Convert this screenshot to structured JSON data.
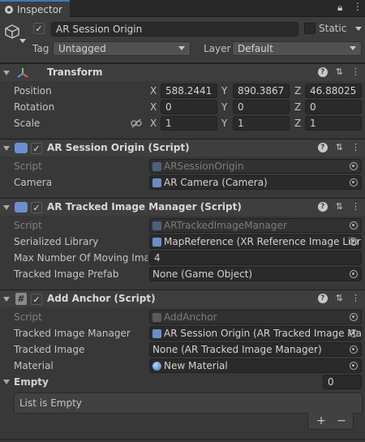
{
  "tab": {
    "title": "Inspector"
  },
  "header": {
    "object_name": "AR Session Origin",
    "static_label": "Static",
    "tag_label": "Tag",
    "tag_value": "Untagged",
    "layer_label": "Layer",
    "layer_value": "Default"
  },
  "transform": {
    "title": "Transform",
    "rows": [
      {
        "label": "Position",
        "x": "588.2441",
        "y": "890.3867",
        "z": "46.88025"
      },
      {
        "label": "Rotation",
        "x": "0",
        "y": "0",
        "z": "0"
      },
      {
        "label": "Scale",
        "x": "1",
        "y": "1",
        "z": "1"
      }
    ],
    "axis": {
      "x": "X",
      "y": "Y",
      "z": "Z"
    }
  },
  "session_origin": {
    "title": "AR Session Origin (Script)",
    "script_label": "Script",
    "script_value": "ARSessionOrigin",
    "camera_label": "Camera",
    "camera_value": "AR Camera (Camera)"
  },
  "image_manager": {
    "title": "AR Tracked Image Manager (Script)",
    "script_label": "Script",
    "script_value": "ARTrackedImageManager",
    "library_label": "Serialized Library",
    "library_value": "MapReference (XR Reference Image Libra",
    "max_label": "Max Number Of Moving Images",
    "max_value": "4",
    "prefab_label": "Tracked Image Prefab",
    "prefab_value": "None (Game Object)"
  },
  "add_anchor": {
    "title": "Add Anchor (Script)",
    "script_label": "Script",
    "script_value": "AddAnchor",
    "tim_label": "Tracked Image Manager",
    "tim_value": "AR Session Origin (AR Tracked Image Ma",
    "ti_label": "Tracked Image",
    "ti_value": "None (AR Tracked Image Manager)",
    "material_label": "Material",
    "material_value": "New Material",
    "empty_label": "Empty",
    "empty_count": "0",
    "list_empty_text": "List is Empty",
    "add_symbol": "+",
    "remove_symbol": "−"
  }
}
